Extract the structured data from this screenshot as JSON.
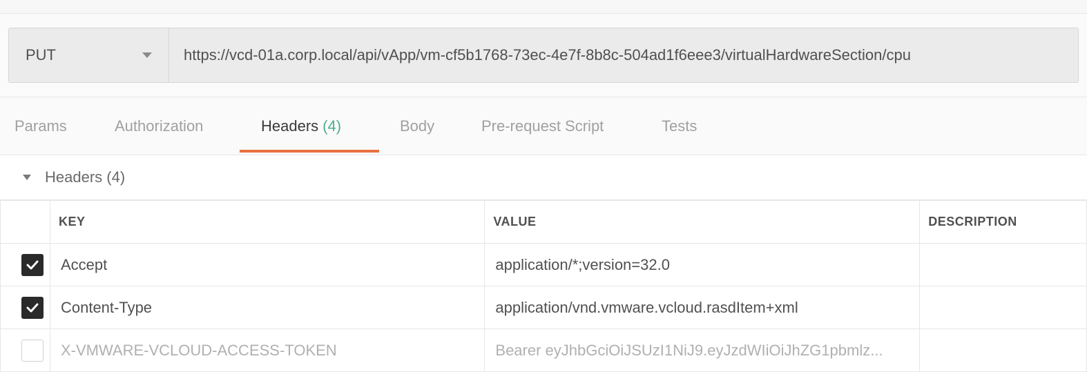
{
  "request": {
    "method": "PUT",
    "url": "https://vcd-01a.corp.local/api/vApp/vm-cf5b1768-73ec-4e7f-8b8c-504ad1f6eee3/virtualHardwareSection/cpu"
  },
  "tabs": [
    {
      "label": "Params",
      "count": ""
    },
    {
      "label": "Authorization",
      "count": ""
    },
    {
      "label": "Headers",
      "count": "(4)"
    },
    {
      "label": "Body",
      "count": ""
    },
    {
      "label": "Pre-request Script",
      "count": ""
    },
    {
      "label": "Tests",
      "count": ""
    }
  ],
  "active_tab": "Headers",
  "section": {
    "title": "Headers (4)"
  },
  "table": {
    "columns": [
      "KEY",
      "VALUE",
      "DESCRIPTION"
    ],
    "rows": [
      {
        "enabled": true,
        "key": "Accept",
        "value": "application/*;version=32.0",
        "description": ""
      },
      {
        "enabled": true,
        "key": "Content-Type",
        "value": "application/vnd.vmware.vcloud.rasdItem+xml",
        "description": ""
      },
      {
        "enabled": false,
        "key": "X-VMWARE-VCLOUD-ACCESS-TOKEN",
        "value": "Bearer eyJhbGciOiJSUzI1NiJ9.eyJzdWIiOiJhZG1pbmlz...",
        "description": ""
      }
    ]
  },
  "colors": {
    "accent": "#e8703f",
    "count": "#4cae8f"
  },
  "icons": {
    "method_caret": "chevron-down-icon",
    "section_caret": "caret-down-icon",
    "checkbox": "check-icon"
  }
}
